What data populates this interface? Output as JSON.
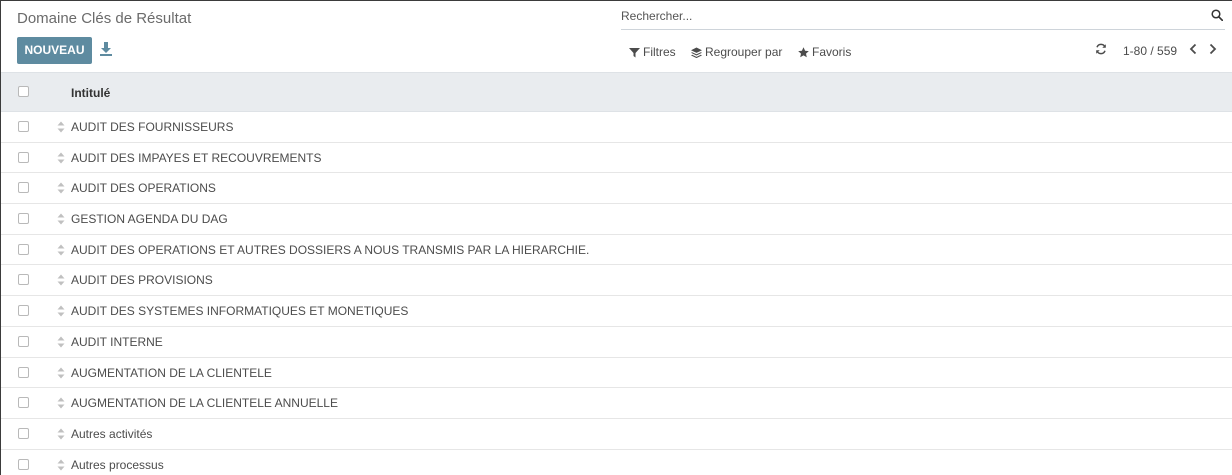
{
  "header": {
    "title": "Domaine Clés de Résultat",
    "new_label": "NOUVEAU",
    "export_icon": "download-icon"
  },
  "search": {
    "placeholder": "Rechercher...",
    "icon": "search-icon"
  },
  "filters": {
    "filtres_label": "Filtres",
    "group_label": "Regrouper par",
    "favoris_label": "Favoris"
  },
  "pager": {
    "value": "1-80 / 559"
  },
  "list": {
    "column_title": "Intitulé",
    "rows": [
      "AUDIT DES FOURNISSEURS",
      "AUDIT DES IMPAYES ET RECOUVREMENTS",
      "AUDIT DES OPERATIONS",
      "GESTION AGENDA DU DAG",
      "AUDIT DES OPERATIONS ET AUTRES DOSSIERS A NOUS TRANSMIS PAR LA HIERARCHIE.",
      "AUDIT DES PROVISIONS",
      "AUDIT DES SYSTEMES INFORMATIQUES ET MONETIQUES",
      "AUDIT INTERNE",
      "AUGMENTATION DE LA CLIENTELE",
      "AUGMENTATION DE LA CLIENTELE ANNUELLE",
      "Autres activités",
      "Autres processus"
    ]
  },
  "colors": {
    "primary": "#5e8ba0",
    "header_bg": "#e9ecef"
  }
}
